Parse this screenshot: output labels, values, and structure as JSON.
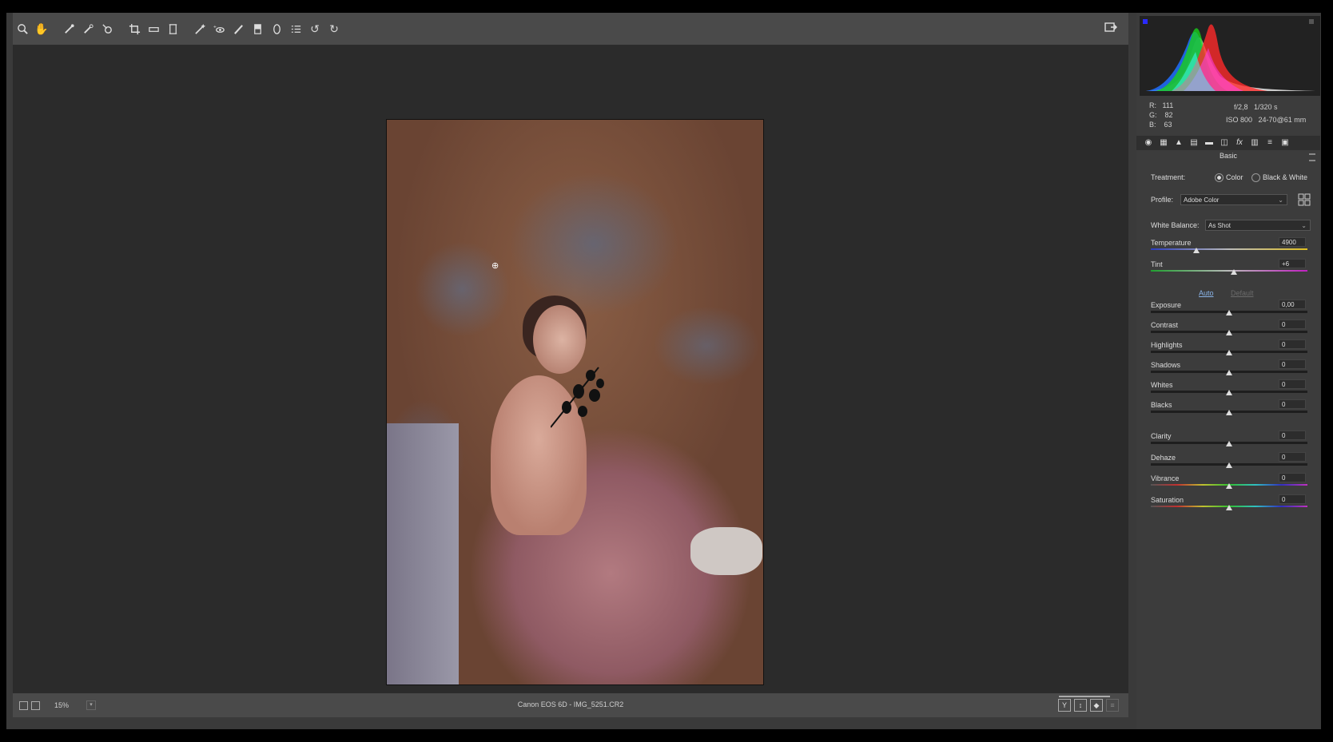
{
  "toolbar": {
    "tools": [
      "zoom-tool",
      "hand-tool",
      "white-balance-tool",
      "color-sampler-tool",
      "targeted-adjustment-tool",
      "crop-tool",
      "straighten-tool",
      "transform-tool",
      "spot-removal-tool",
      "red-eye-tool",
      "adjustment-brush-tool",
      "graduated-filter-tool",
      "radial-filter-tool",
      "presets-tool",
      "rotate-left-tool",
      "rotate-right-tool"
    ]
  },
  "status": {
    "zoom": "15%",
    "file_info": "Canon EOS 6D  -  IMG_5251.CR2",
    "view_buttons": [
      "Y",
      "↕",
      "◆"
    ]
  },
  "readout": {
    "r_label": "R:",
    "r": "111",
    "g_label": "G:",
    "g": "82",
    "b_label": "B:",
    "b": "63",
    "aperture": "f/2,8",
    "shutter": "1/320 s",
    "iso": "ISO 800",
    "lens": "24-70@61 mm"
  },
  "panel": {
    "section": "Basic",
    "treatment_label": "Treatment:",
    "treatment_color": "Color",
    "treatment_bw": "Black & White",
    "profile_label": "Profile:",
    "profile_value": "Adobe Color",
    "wb_label": "White Balance:",
    "wb_value": "As Shot",
    "auto": "Auto",
    "default": "Default",
    "sliders": [
      {
        "label": "Temperature",
        "value": "4900",
        "level": 0.29
      },
      {
        "label": "Tint",
        "value": "+6",
        "level": 0.53
      },
      {
        "label": "Exposure",
        "value": "0,00",
        "level": 0.5
      },
      {
        "label": "Contrast",
        "value": "0",
        "level": 0.5
      },
      {
        "label": "Highlights",
        "value": "0",
        "level": 0.5
      },
      {
        "label": "Shadows",
        "value": "0",
        "level": 0.5
      },
      {
        "label": "Whites",
        "value": "0",
        "level": 0.5
      },
      {
        "label": "Blacks",
        "value": "0",
        "level": 0.5
      },
      {
        "label": "Clarity",
        "value": "0",
        "level": 0.5
      },
      {
        "label": "Dehaze",
        "value": "0",
        "level": 0.5
      },
      {
        "label": "Vibrance",
        "value": "0",
        "level": 0.5
      },
      {
        "label": "Saturation",
        "value": "0",
        "level": 0.5
      }
    ]
  },
  "colors": {
    "panel_bg": "#3c3c3c",
    "canvas_bg": "#2b2b2b",
    "toolbar_bg": "#4a4a4a",
    "link": "#8ab4e8"
  }
}
